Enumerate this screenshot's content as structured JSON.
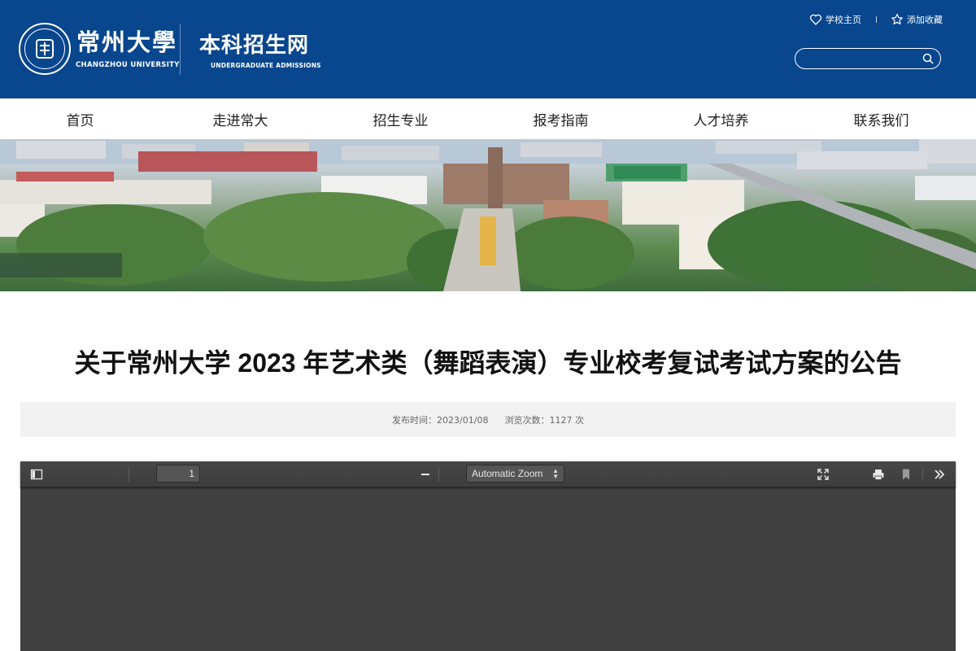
{
  "header": {
    "university_cn": "常州大學",
    "university_en": "CHANGZHOU UNIVERSITY",
    "site_cn": "本科招生网",
    "site_en": "UNDERGRADUATE ADMISSIONS",
    "links": [
      {
        "label": "学校主页",
        "icon": "heart-icon"
      },
      {
        "label": "添加收藏",
        "icon": "star-icon"
      }
    ],
    "search": {
      "placeholder": "",
      "icon": "search-icon"
    }
  },
  "nav": {
    "items": [
      "首页",
      "走进常大",
      "招生专业",
      "报考指南",
      "人才培养",
      "联系我们"
    ]
  },
  "article": {
    "title": "关于常州大学 2023 年艺术类（舞蹈表演）专业校考复试考试方案的公告",
    "publish_label": "发布时间：2023/01/08",
    "views_label": "浏览次数：1127 次"
  },
  "viewer": {
    "page_number": "1",
    "zoom": "Automatic Zoom",
    "icons": [
      "sidebar-toggle-icon",
      "zoom-out-icon",
      "presentation-mode-icon",
      "print-icon",
      "bookmark-icon",
      "tools-icon"
    ]
  },
  "colors": {
    "header_bg": "#08468e",
    "viewer_bg": "#404040",
    "meta_bg": "#f2f2f2"
  }
}
